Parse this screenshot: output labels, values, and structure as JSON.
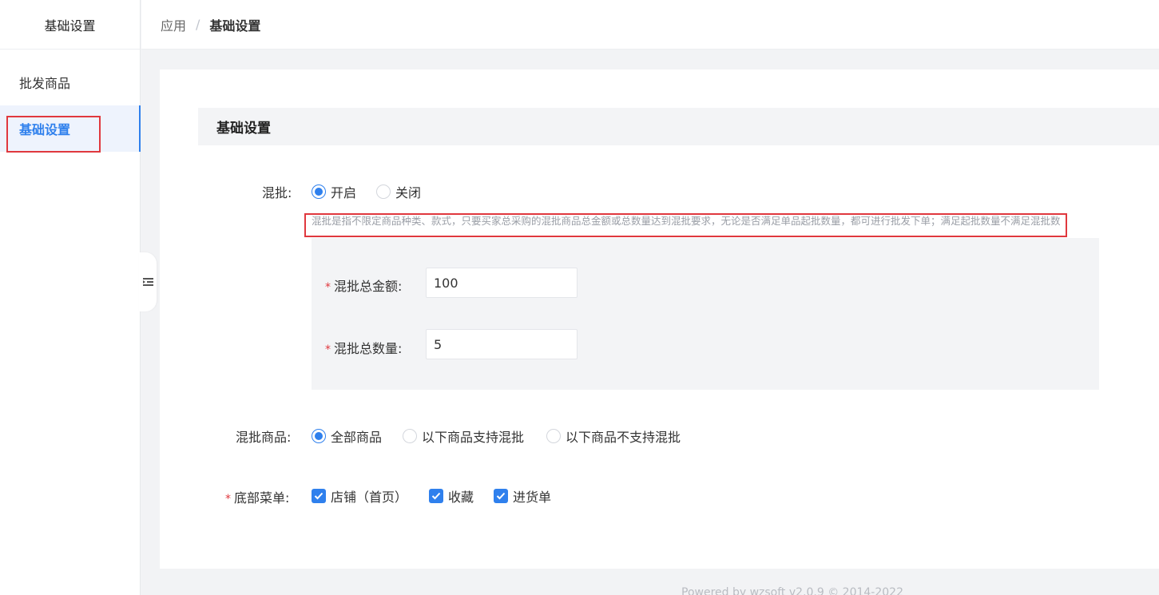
{
  "sidebar": {
    "title": "基础设置",
    "items": [
      {
        "label": "批发商品"
      },
      {
        "label": "基础设置"
      }
    ]
  },
  "breadcrumb": {
    "parent": "应用",
    "separator": "/",
    "current": "基础设置"
  },
  "section": {
    "title": "基础设置"
  },
  "mix": {
    "label": "混批:",
    "options": [
      {
        "label": "开启",
        "selected": true
      },
      {
        "label": "关闭",
        "selected": false
      }
    ],
    "hint": "混批是指不限定商品种类、款式，只要买家总采购的混批商品总金额或总数量达到混批要求，无论是否满足单品起批数量，都可进行批发下单；满足起批数量不满足混批数"
  },
  "mix_amount": {
    "label": "混批总金额:",
    "value": "100"
  },
  "mix_quantity": {
    "label": "混批总数量:",
    "value": "5"
  },
  "mix_goods": {
    "label": "混批商品:",
    "options": [
      {
        "label": "全部商品",
        "selected": true
      },
      {
        "label": "以下商品支持混批",
        "selected": false
      },
      {
        "label": "以下商品不支持混批",
        "selected": false
      }
    ]
  },
  "bottom_menu": {
    "label": "底部菜单:",
    "options": [
      {
        "label": "店铺（首页）",
        "checked": true
      },
      {
        "label": "收藏",
        "checked": true
      },
      {
        "label": "进货单",
        "checked": true
      }
    ]
  },
  "footer": {
    "text": "Powered by wzsoft v2.0.9 © 2014-2022"
  },
  "colors": {
    "accent": "#2f80ed",
    "highlight": "#e0383e",
    "required": "#e0383e"
  }
}
